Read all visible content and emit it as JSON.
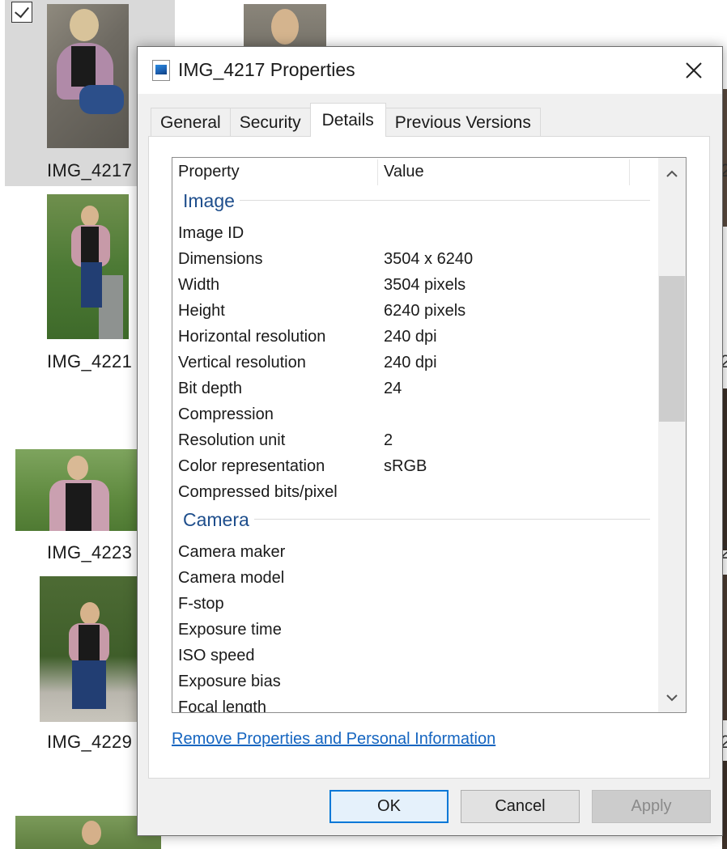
{
  "explorer": {
    "thumbnails": [
      {
        "label": "IMG_4217",
        "selected": true
      },
      {
        "label": "IMG_4221"
      },
      {
        "label": "IMG_4223"
      },
      {
        "label": "IMG_4229"
      }
    ],
    "edge_char": "2"
  },
  "dialog": {
    "title": "IMG_4217 Properties",
    "tabs": [
      "General",
      "Security",
      "Details",
      "Previous Versions"
    ],
    "active_tab": "Details",
    "table": {
      "columns": [
        "Property",
        "Value"
      ],
      "groups": [
        {
          "name": "Image",
          "rows": [
            {
              "property": "Image ID",
              "value": ""
            },
            {
              "property": "Dimensions",
              "value": "3504 x 6240"
            },
            {
              "property": "Width",
              "value": "3504 pixels"
            },
            {
              "property": "Height",
              "value": "6240 pixels"
            },
            {
              "property": "Horizontal resolution",
              "value": "240 dpi"
            },
            {
              "property": "Vertical resolution",
              "value": "240 dpi"
            },
            {
              "property": "Bit depth",
              "value": "24"
            },
            {
              "property": "Compression",
              "value": ""
            },
            {
              "property": "Resolution unit",
              "value": "2"
            },
            {
              "property": "Color representation",
              "value": "sRGB"
            },
            {
              "property": "Compressed bits/pixel",
              "value": ""
            }
          ]
        },
        {
          "name": "Camera",
          "rows": [
            {
              "property": "Camera maker",
              "value": ""
            },
            {
              "property": "Camera model",
              "value": ""
            },
            {
              "property": "F-stop",
              "value": ""
            },
            {
              "property": "Exposure time",
              "value": ""
            },
            {
              "property": "ISO speed",
              "value": ""
            },
            {
              "property": "Exposure bias",
              "value": ""
            },
            {
              "property": "Focal length",
              "value": ""
            }
          ]
        }
      ]
    },
    "remove_link": "Remove Properties and Personal Information",
    "buttons": {
      "ok": "OK",
      "cancel": "Cancel",
      "apply": "Apply"
    }
  },
  "colors": {
    "group_heading": "#1e4e8c",
    "link": "#1565c0",
    "ok_border": "#0078d7"
  },
  "icons": {
    "title_icon": "image-file-icon",
    "close": "close-icon",
    "scroll_up": "chevron-up-icon",
    "scroll_down": "chevron-down-icon",
    "checkbox": "checkbox-checked-icon"
  }
}
